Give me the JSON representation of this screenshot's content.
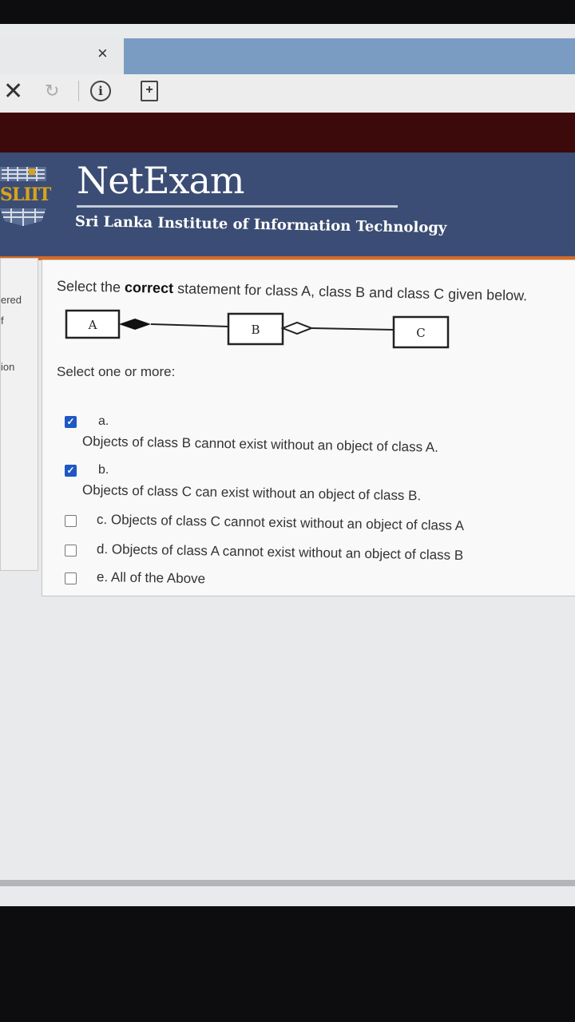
{
  "browser": {
    "tab_close_glyph": "×",
    "stop_glyph": "✕",
    "refresh_glyph": "↻",
    "info_glyph": "i",
    "page_glyph": "+"
  },
  "site": {
    "logo_text": "SLIIT",
    "title": "NetExam",
    "subtitle": "Sri Lanka Institute of Information Technology"
  },
  "side_panel": {
    "labels": [
      "ered",
      "f",
      "ion"
    ]
  },
  "question": {
    "text_before": "Select the ",
    "text_bold": "correct",
    "text_after": " statement for class A, class B and class C given below.",
    "diagram": {
      "class_a": "A",
      "class_b": "B",
      "class_c": "C",
      "a_b_relation": "composition",
      "b_c_relation": "aggregation"
    },
    "select_label": "Select one or more:",
    "options": [
      {
        "letter": "a.",
        "text": "Objects of class B cannot exist without an object of class A.",
        "checked": true
      },
      {
        "letter": "b.",
        "text": "Objects of class C can exist without an object of class B.",
        "checked": true
      },
      {
        "letter": "",
        "text": "c. Objects of class C cannot exist without an object of class A",
        "checked": false
      },
      {
        "letter": "",
        "text": "d. Objects of class A cannot exist without an object of class B",
        "checked": false
      },
      {
        "letter": "",
        "text": "e. All of the Above",
        "checked": false
      }
    ]
  },
  "colors": {
    "header_bg": "#3b4d74",
    "header_accent": "#d96a21",
    "dark_bar": "#3d0a0c",
    "checkbox_checked": "#1f57c3"
  }
}
